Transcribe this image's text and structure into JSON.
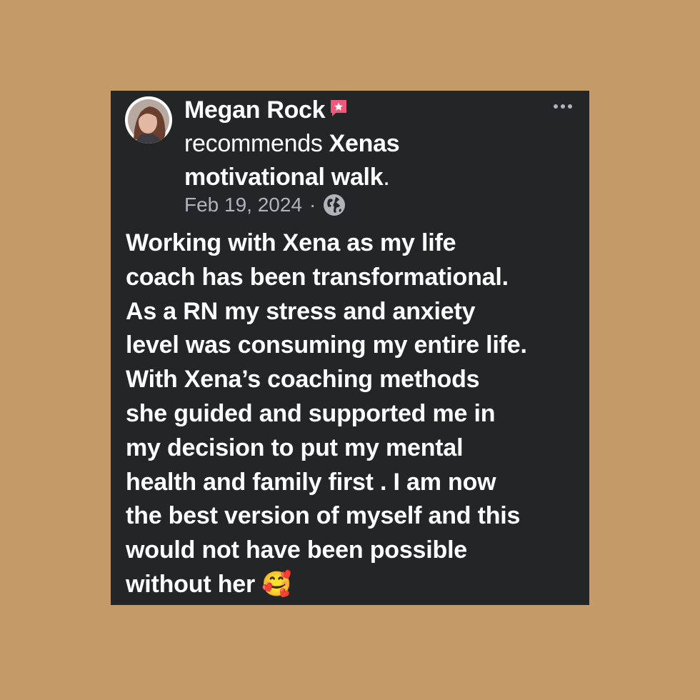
{
  "colors": {
    "page_background": "#c49a68",
    "card_background": "#242526",
    "text_primary": "#ffffff",
    "text_secondary": "#b0b3b8",
    "badge": "#f0587a"
  },
  "post": {
    "author": "Megan Rock",
    "badge_icon": "recommendation-badge-icon",
    "action_text": "recommends",
    "page_name": "Xenas motivational walk",
    "period": ".",
    "date": "Feb 19, 2024",
    "separator": "·",
    "privacy_icon": "globe-icon",
    "more_icon": "more-options-icon",
    "body": "Working with Xena as my life\ncoach has been transformational.\nAs a RN my stress and anxiety\nlevel was consuming my entire life.\nWith Xena’s coaching methods\nshe guided and supported me in\nmy decision to put my mental\nhealth and family first . I am now\nthe best version of myself and this\nwould not have been possible\nwithout her 🥰"
  }
}
